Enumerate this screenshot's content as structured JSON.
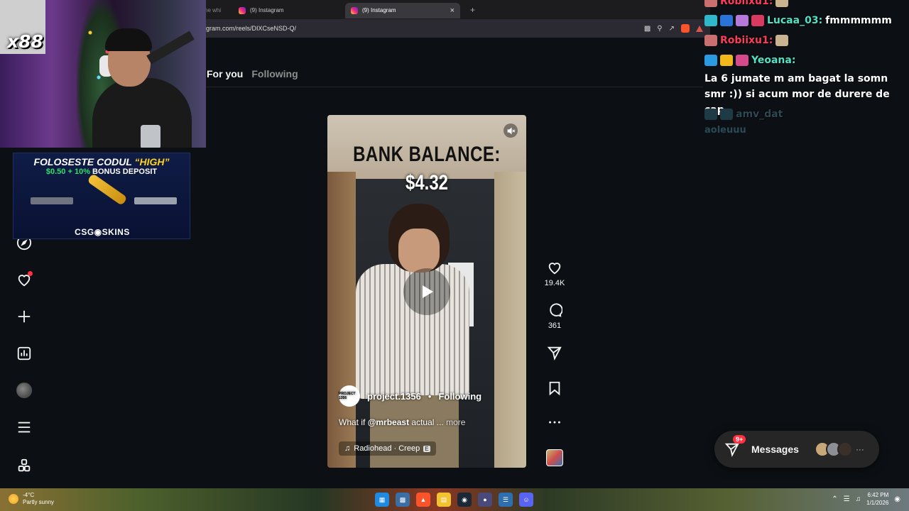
{
  "browser": {
    "tabs": [
      {
        "title": "ne whi"
      },
      {
        "title": "(9) Instagram"
      },
      {
        "title": "(9) Instagram",
        "active": true
      }
    ],
    "new_tab": "+",
    "close": "×",
    "url": "gram.com/reels/DIXCseNSD-Q/"
  },
  "feed": {
    "tab_for_you": "For you",
    "tab_following": "Following"
  },
  "nav_icons": [
    "explore-icon",
    "notifications-icon",
    "create-icon",
    "dashboard-icon",
    "profile-avatar",
    "more-menu-icon",
    "also-from-meta-icon"
  ],
  "reel": {
    "overlay_title": "BANK BALANCE:",
    "overlay_amount": "$4.32",
    "username": "project.1356",
    "dot": "•",
    "follow_status": "Following",
    "avatar_text": "PROJECT 1356",
    "caption_prefix": "What if ",
    "caption_mention": "@mrbeast",
    "caption_rest": " actual ...",
    "caption_more": " more",
    "audio": "Radiohead · Creep",
    "explicit_badge": "E"
  },
  "actions": {
    "likes": "19.4K",
    "comments": "361"
  },
  "messages": {
    "label": "Messages",
    "badge": "9+",
    "more": "···"
  },
  "overlay": {
    "webcam_tag": "x88",
    "sponsor_line1_a": "FOLOSESTE CODUL ",
    "sponsor_line1_b": "“HIGH”",
    "sponsor_line2_a": "$0.50 + 10% ",
    "sponsor_line2_b": "BONUS DEPOSIT",
    "sponsor_brand": "CSG◉SKINS"
  },
  "chat": {
    "line1_user": "Robiixu1:",
    "line2_user": "Lucaa_03:",
    "line2_msg": "fmmmmmm",
    "line3_user": "Robiixu1:",
    "line4_user": "Yeoana:",
    "line4_msg": "La 6 jumate m am bagat la somn smr :)) si acum mor de durere de cap",
    "line5_user": "amv_dat",
    "line5_msg": "aoleuuu"
  },
  "taskbar": {
    "temp": "-4°C",
    "weather": "Partly sunny",
    "time": "6:42 PM",
    "date": "1/1/2026"
  },
  "colors": {
    "ig_bg": "#0c1014",
    "like_red": "#ff3040",
    "chat_red": "#ff3b5c",
    "chat_cyan": "#4fe3c8"
  }
}
